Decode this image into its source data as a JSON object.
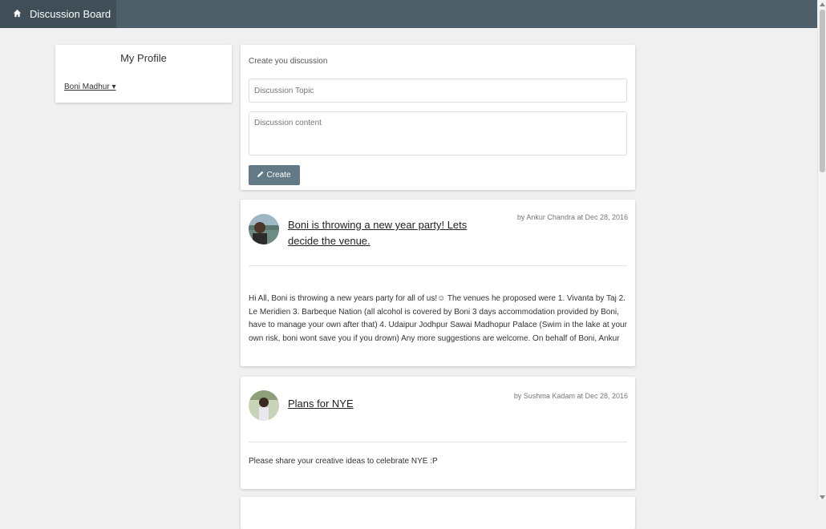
{
  "nav": {
    "brand": "Discussion Board",
    "brand_icon": "home-icon"
  },
  "profile": {
    "title": "My Profile",
    "user": "Boni Madhur ▾"
  },
  "create": {
    "title": "Create you discussion",
    "title_placeholder": "Discussion Topic",
    "content_placeholder": "Discussion content",
    "button_label": "Create",
    "button_icon": "pencil-icon"
  },
  "posts": [
    {
      "title": "Boni is throwing a new year party! Lets decide the venue.",
      "meta": "by Ankur Chandra at Dec 28, 2016",
      "body": "Hi All, Boni is throwing a new years party for all of us!☺ The venues he proposed were 1. Vivanta by Taj 2. Le Meridien 3. Barbeque Nation (all alcohol is covered by Boni 3 days accommodation provided by Boni, have to manage your own after that) 4. Udaipur Jodhpur Sawai Madhopur Palace (Swim in the lake at your own risk, boni wont save you if you drown) Any more suggestions are welcome. On behalf of Boni, Ankur",
      "avatar": "avatar-man"
    },
    {
      "title": "Plans for NYE",
      "meta": "by Sushma Kadam at Dec 28, 2016",
      "body": "Please share your creative ideas to celebrate NYE :P",
      "avatar": "avatar-woman"
    }
  ],
  "colors": {
    "topbar": "#4e5f69",
    "brand_bg": "#3f4e57",
    "button": "#617a86",
    "background": "#f0f0f0"
  }
}
